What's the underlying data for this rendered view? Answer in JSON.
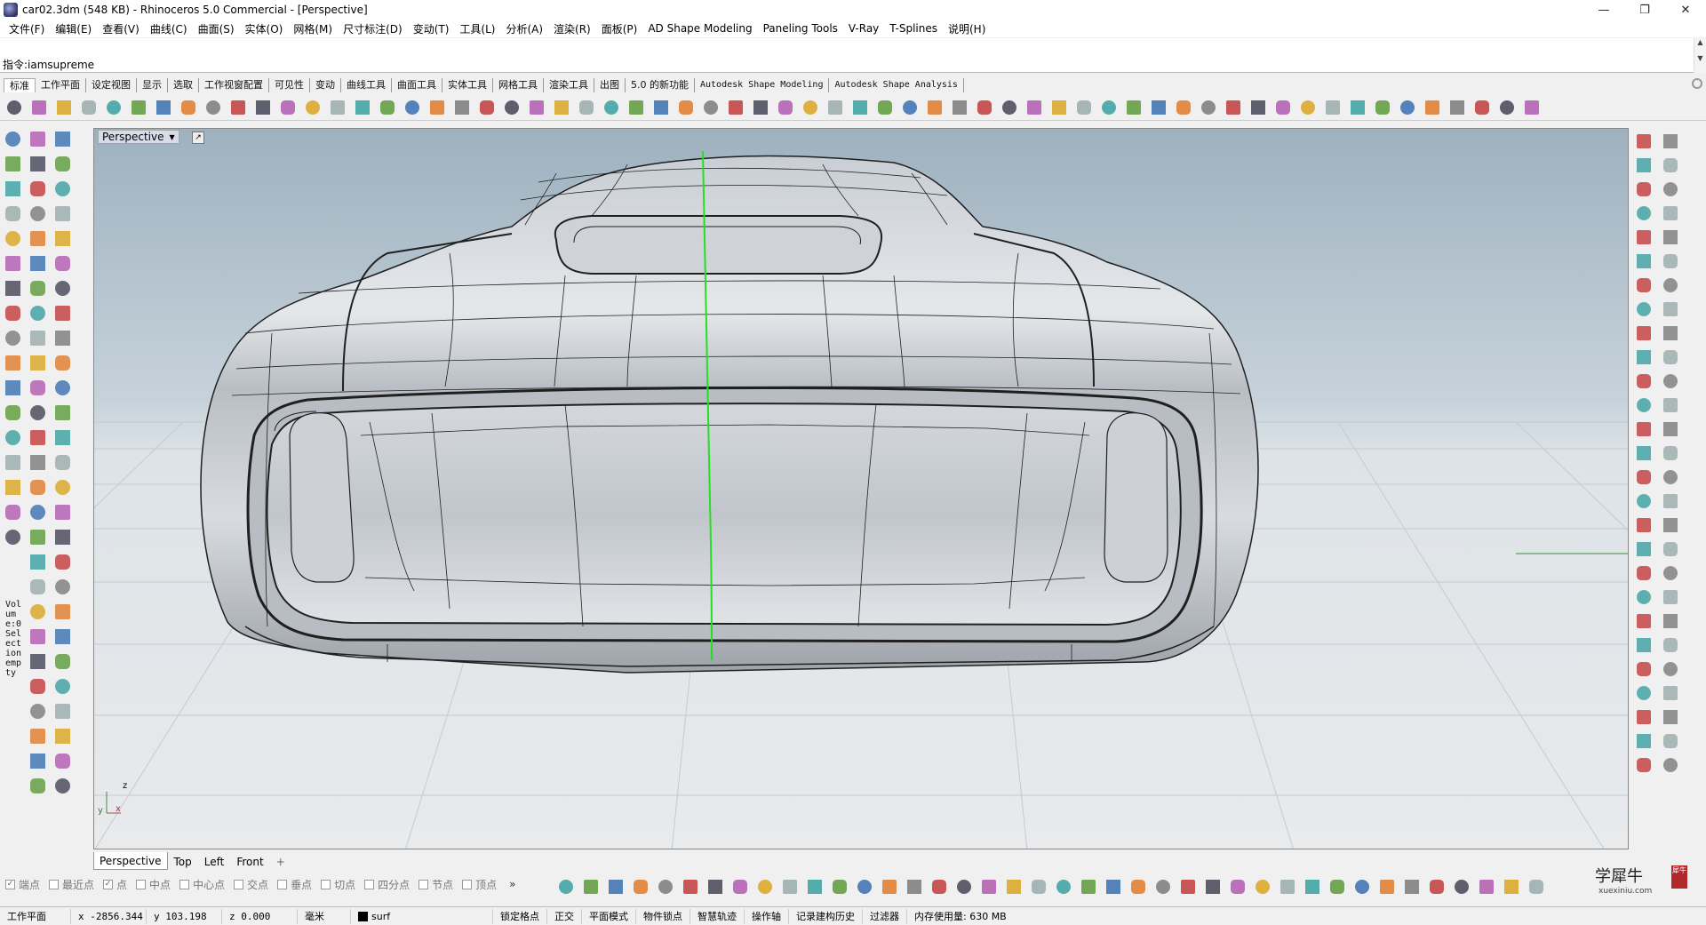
{
  "window": {
    "title": "car02.3dm (548 KB) - Rhinoceros 5.0 Commercial - [Perspective]",
    "min_glyph": "—",
    "max_glyph": "❐",
    "close_glyph": "✕"
  },
  "menu": [
    "文件(F)",
    "编辑(E)",
    "查看(V)",
    "曲线(C)",
    "曲面(S)",
    "实体(O)",
    "网格(M)",
    "尺寸标注(D)",
    "变动(T)",
    "工具(L)",
    "分析(A)",
    "渲染(R)",
    "面板(P)",
    "AD Shape Modeling",
    "Paneling Tools",
    "V-Ray",
    "T-Splines",
    "说明(H)"
  ],
  "command": {
    "label": "指令:",
    "value": "iamsupreme"
  },
  "toolbar_tabs": [
    {
      "label": "标准",
      "active": true
    },
    {
      "label": "工作平面"
    },
    {
      "label": "设定视图"
    },
    {
      "label": "显示"
    },
    {
      "label": "选取"
    },
    {
      "label": "工作视窗配置"
    },
    {
      "label": "可见性"
    },
    {
      "label": "变动"
    },
    {
      "label": "曲线工具"
    },
    {
      "label": "曲面工具"
    },
    {
      "label": "实体工具"
    },
    {
      "label": "网格工具"
    },
    {
      "label": "渲染工具"
    },
    {
      "label": "出图"
    },
    {
      "label": "5.0 的新功能"
    },
    {
      "label": "Autodesk Shape Modeling",
      "mono": true
    },
    {
      "label": "Autodesk Shape Analysis",
      "mono": true
    }
  ],
  "viewport": {
    "label": "Perspective",
    "axis_z": "z",
    "axis_y": "y",
    "axis_x": "x"
  },
  "left_panel_text": "Volume:0Selectionempty",
  "viewport_tabs": [
    "Perspective",
    "Top",
    "Left",
    "Front"
  ],
  "viewport_tab_add": "+",
  "osnaps": [
    {
      "label": "端点",
      "checked": true
    },
    {
      "label": "最近点",
      "checked": false
    },
    {
      "label": "点",
      "checked": true
    },
    {
      "label": "中点",
      "checked": false
    },
    {
      "label": "中心点",
      "checked": false
    },
    {
      "label": "交点",
      "checked": false
    },
    {
      "label": "垂点",
      "checked": false
    },
    {
      "label": "切点",
      "checked": false
    },
    {
      "label": "四分点",
      "checked": false
    },
    {
      "label": "节点",
      "checked": false
    },
    {
      "label": "顶点",
      "checked": false
    }
  ],
  "osnap_more": "»",
  "watermark": {
    "main": "学犀牛",
    "url": "xuexiniu.com",
    "seal": "犀牛"
  },
  "status": {
    "cplane": "工作平面",
    "x": "x -2856.344",
    "y": "y 103.198",
    "z": "z 0.000",
    "units": "毫米",
    "layer": "surf",
    "grid_snap": "锁定格点",
    "ortho": "正交",
    "planar": "平面模式",
    "osnap": "物件锁点",
    "smarttrack": "智慧轨迹",
    "gumball": "操作轴",
    "history": "记录建构历史",
    "filter": "过滤器",
    "memory": "内存使用量: 630 MB"
  },
  "colors": {
    "sky_top": "#9fb2c0",
    "sky_bottom": "#d2dde4",
    "ground": "#e0e3e5",
    "body_surface": "#d7dbe0",
    "center_line": "#22e022"
  }
}
